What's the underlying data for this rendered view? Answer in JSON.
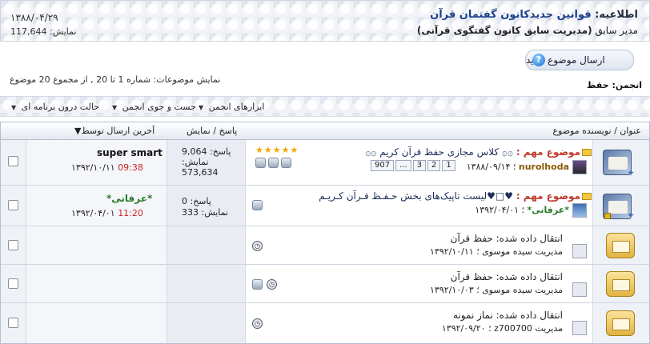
{
  "announcement": {
    "label": "اطلاعیه:",
    "title": "قوانین جدیدکانون گفتمان قرآن",
    "by_label": "مدیر سابق",
    "by_name": "(مدیریت سابق کانون گفتگوی قرآنی)",
    "date": "۱۳۸۸/۰۴/۲۹",
    "views": "نمایش: 117,644"
  },
  "new_thread_label": "ارسال موضوع جدید",
  "page_info": "نمایش موضوعات: شماره 1 تا 20 , از مجموع 20 موضوع",
  "forum_name": "انجمن: حفظ",
  "toolbar": {
    "tools": "ابزارهای انجمن",
    "search": "جست و جوی انجمن",
    "mode": "حالت درون برنامه ای"
  },
  "table": {
    "col_title": "عنوان / نویسنده موضوع",
    "col_stats": "پاسخ / نمایش",
    "col_last": "آخرین ارسال توسط"
  },
  "rows": [
    {
      "prefix": "موضوع مهم :",
      "title": "۞۞ کلاس مجازی حفظ قرآن کریم ۞۞",
      "author": "nurolhoda",
      "date": "۱۳۸۸/۰۹/۱۴",
      "pages": [
        "1",
        "2",
        "3",
        "...",
        "907"
      ],
      "replies": "پاسخ: 9,064",
      "views_label": "نمایش:",
      "views": "573,634",
      "last_user": "super smart",
      "last_date": "۱۳۹۲/۱۰/۱۱",
      "last_time": "09:38"
    },
    {
      "prefix": "موضوع مهم :",
      "title": "♥□♥لیست تاپیک‌های بخش حـفـظ قـرآن کـریـم",
      "author": "*عرفانی*",
      "date": "۱۳۹۲/۰۴/۰۱",
      "replies": "پاسخ: 0",
      "views": "نمایش: 333",
      "last_user": "*عرفانی*",
      "last_date": "۱۳۹۲/۰۴/۰۱",
      "last_time": "11:20"
    },
    {
      "title": "انتقال داده شده: حفظ قرآن",
      "author": "مدیریت سیده موسوی",
      "date": "۱۳۹۲/۱۰/۱۱"
    },
    {
      "title": "انتقال داده شده: حفظ قرآن",
      "author": "مدیریت سیده موسوی",
      "date": "۱۳۹۲/۱۰/۰۳"
    },
    {
      "title": "انتقال داده شده: نماز نمونه",
      "author": "مدیریت z700700",
      "date": "۱۳۹۲/۰۹/۲۰"
    }
  ],
  "colors": {
    "link": "#1c3f8c",
    "important": "#c0392b",
    "time": "#cc2222",
    "header_grad_bottom": "#e4e8f0"
  }
}
